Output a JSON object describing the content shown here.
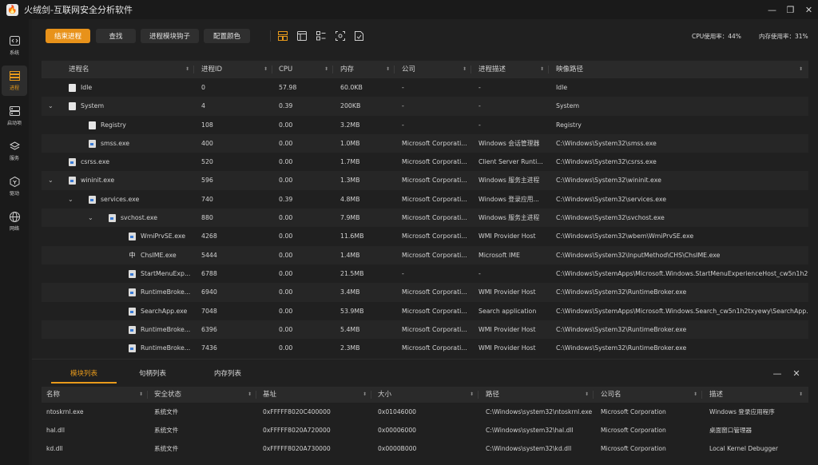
{
  "window": {
    "title": "火绒剑-互联网安全分析软件"
  },
  "sidebar": {
    "items": [
      {
        "id": "system",
        "label": "系统",
        "icon": "code-window-icon",
        "active": false
      },
      {
        "id": "process",
        "label": "进程",
        "icon": "process-list-icon",
        "active": true
      },
      {
        "id": "startup",
        "label": "启动项",
        "icon": "startup-icon",
        "active": false
      },
      {
        "id": "service",
        "label": "服务",
        "icon": "service-icon",
        "active": false
      },
      {
        "id": "driver",
        "label": "驱动",
        "icon": "driver-icon",
        "active": false
      },
      {
        "id": "network",
        "label": "网络",
        "icon": "globe-icon",
        "active": false
      }
    ]
  },
  "toolbar": {
    "end_process": "结束进程",
    "find": "查找",
    "process_module_hook": "进程模块钩子",
    "config_color": "配置颜色",
    "cpu_usage_label": "CPU使用率：",
    "cpu_usage_value": "44%",
    "mem_usage_label": "内存使用率：",
    "mem_usage_value": "31%"
  },
  "process_table": {
    "columns": [
      "进程名",
      "进程ID",
      "CPU",
      "内存",
      "公司",
      "进程描述",
      "映像路径"
    ],
    "rows": [
      {
        "level": 0,
        "toggle": "",
        "icon": "doc",
        "name": "Idle",
        "pid": "0",
        "cpu": "57.98",
        "mem": "60.0KB",
        "company": "-",
        "desc": "-",
        "path": "Idle"
      },
      {
        "level": 0,
        "toggle": "⌄",
        "icon": "doc",
        "name": "System",
        "pid": "4",
        "cpu": "0.39",
        "mem": "200KB",
        "company": "-",
        "desc": "-",
        "path": "System"
      },
      {
        "level": 1,
        "toggle": "",
        "icon": "doc",
        "name": "Registry",
        "pid": "108",
        "cpu": "0.00",
        "mem": "3.2MB",
        "company": "-",
        "desc": "-",
        "path": "Registry"
      },
      {
        "level": 1,
        "toggle": "",
        "icon": "win",
        "name": "smss.exe",
        "pid": "400",
        "cpu": "0.00",
        "mem": "1.0MB",
        "company": "Microsoft Corporati...",
        "desc": "Windows 会话管理器",
        "path": "C:\\Windows\\System32\\smss.exe"
      },
      {
        "level": 0,
        "toggle": "",
        "icon": "win",
        "name": "csrss.exe",
        "pid": "520",
        "cpu": "0.00",
        "mem": "1.7MB",
        "company": "Microsoft Corporati...",
        "desc": "Client Server Runti...",
        "path": "C:\\Windows\\System32\\csrss.exe"
      },
      {
        "level": 0,
        "toggle": "⌄",
        "icon": "win",
        "name": "wininit.exe",
        "pid": "596",
        "cpu": "0.00",
        "mem": "1.3MB",
        "company": "Microsoft Corporati...",
        "desc": "Windows 服务主进程",
        "path": "C:\\Windows\\System32\\wininit.exe"
      },
      {
        "level": 1,
        "toggle": "⌄",
        "icon": "win",
        "name": "services.exe",
        "pid": "740",
        "cpu": "0.39",
        "mem": "4.8MB",
        "company": "Microsoft Corporati...",
        "desc": "Windows 登录应用...",
        "path": "C:\\Windows\\System32\\services.exe"
      },
      {
        "level": 2,
        "toggle": "⌄",
        "icon": "win",
        "name": "svchost.exe",
        "pid": "880",
        "cpu": "0.00",
        "mem": "7.9MB",
        "company": "Microsoft Corporati...",
        "desc": "Windows 服务主进程",
        "path": "C:\\Windows\\System32\\svchost.exe"
      },
      {
        "level": 3,
        "toggle": "",
        "icon": "win",
        "name": "WmiPrvSE.exe",
        "pid": "4268",
        "cpu": "0.00",
        "mem": "11.6MB",
        "company": "Microsoft Corporati...",
        "desc": "WMI Provider Host",
        "path": "C:\\Windows\\System32\\wbem\\WmiPrvSE.exe"
      },
      {
        "level": 3,
        "toggle": "",
        "icon": "zh",
        "name": "ChsIME.exe",
        "pid": "5444",
        "cpu": "0.00",
        "mem": "1.4MB",
        "company": "Microsoft Corporati...",
        "desc": "Microsoft IME",
        "path": "C:\\Windows\\System32\\InputMethod\\CHS\\ChsIME.exe"
      },
      {
        "level": 3,
        "toggle": "",
        "icon": "win",
        "name": "StartMenuExp...",
        "pid": "6788",
        "cpu": "0.00",
        "mem": "21.5MB",
        "company": "-",
        "desc": "-",
        "path": "C:\\Windows\\SystemApps\\Microsoft.Windows.StartMenuExperienceHost_cw5n1h2t..."
      },
      {
        "level": 3,
        "toggle": "",
        "icon": "win",
        "name": "RuntimeBroke...",
        "pid": "6940",
        "cpu": "0.00",
        "mem": "3.4MB",
        "company": "Microsoft Corporati...",
        "desc": "WMI Provider Host",
        "path": "C:\\Windows\\System32\\RuntimeBroker.exe"
      },
      {
        "level": 3,
        "toggle": "",
        "icon": "win",
        "name": "SearchApp.exe",
        "pid": "7048",
        "cpu": "0.00",
        "mem": "53.9MB",
        "company": "Microsoft Corporati...",
        "desc": "Search application",
        "path": "C:\\Windows\\SystemApps\\Microsoft.Windows.Search_cw5n1h2txyewy\\SearchApp...."
      },
      {
        "level": 3,
        "toggle": "",
        "icon": "win",
        "name": "RuntimeBroke...",
        "pid": "6396",
        "cpu": "0.00",
        "mem": "5.4MB",
        "company": "Microsoft Corporati...",
        "desc": "WMI Provider Host",
        "path": "C:\\Windows\\System32\\RuntimeBroker.exe"
      },
      {
        "level": 3,
        "toggle": "",
        "icon": "win",
        "name": "RuntimeBroke...",
        "pid": "7436",
        "cpu": "0.00",
        "mem": "2.3MB",
        "company": "Microsoft Corporati...",
        "desc": "WMI Provider Host",
        "path": "C:\\Windows\\System32\\RuntimeBroker.exe"
      }
    ]
  },
  "bottom_panel": {
    "tabs": [
      "模块列表",
      "句柄列表",
      "内存列表"
    ],
    "active_tab": 0,
    "columns": [
      "名称",
      "安全状态",
      "基址",
      "大小",
      "路径",
      "公司名",
      "描述"
    ],
    "rows": [
      [
        "ntoskrnl.exe",
        "系统文件",
        "0xFFFFF8020C400000",
        "0x01046000",
        "C:\\Windows\\system32\\ntoskrnl.exe",
        "Microsoft Corporation",
        "Windows 登录应用程序"
      ],
      [
        "hal.dll",
        "系统文件",
        "0xFFFFF8020A720000",
        "0x00006000",
        "C:\\Windows\\system32\\hal.dll",
        "Microsoft Corporation",
        "桌面窗口管理器"
      ],
      [
        "kd.dll",
        "系统文件",
        "0xFFFFF8020A730000",
        "0x0000B000",
        "C:\\Windows\\system32\\kd.dll",
        "Microsoft Corporation",
        "Local Kernel Debugger"
      ]
    ]
  },
  "colors": {
    "accent": "#e8921a",
    "background": "#202020",
    "sidebar": "#1a1a1a",
    "header": "#2a2a2a"
  }
}
